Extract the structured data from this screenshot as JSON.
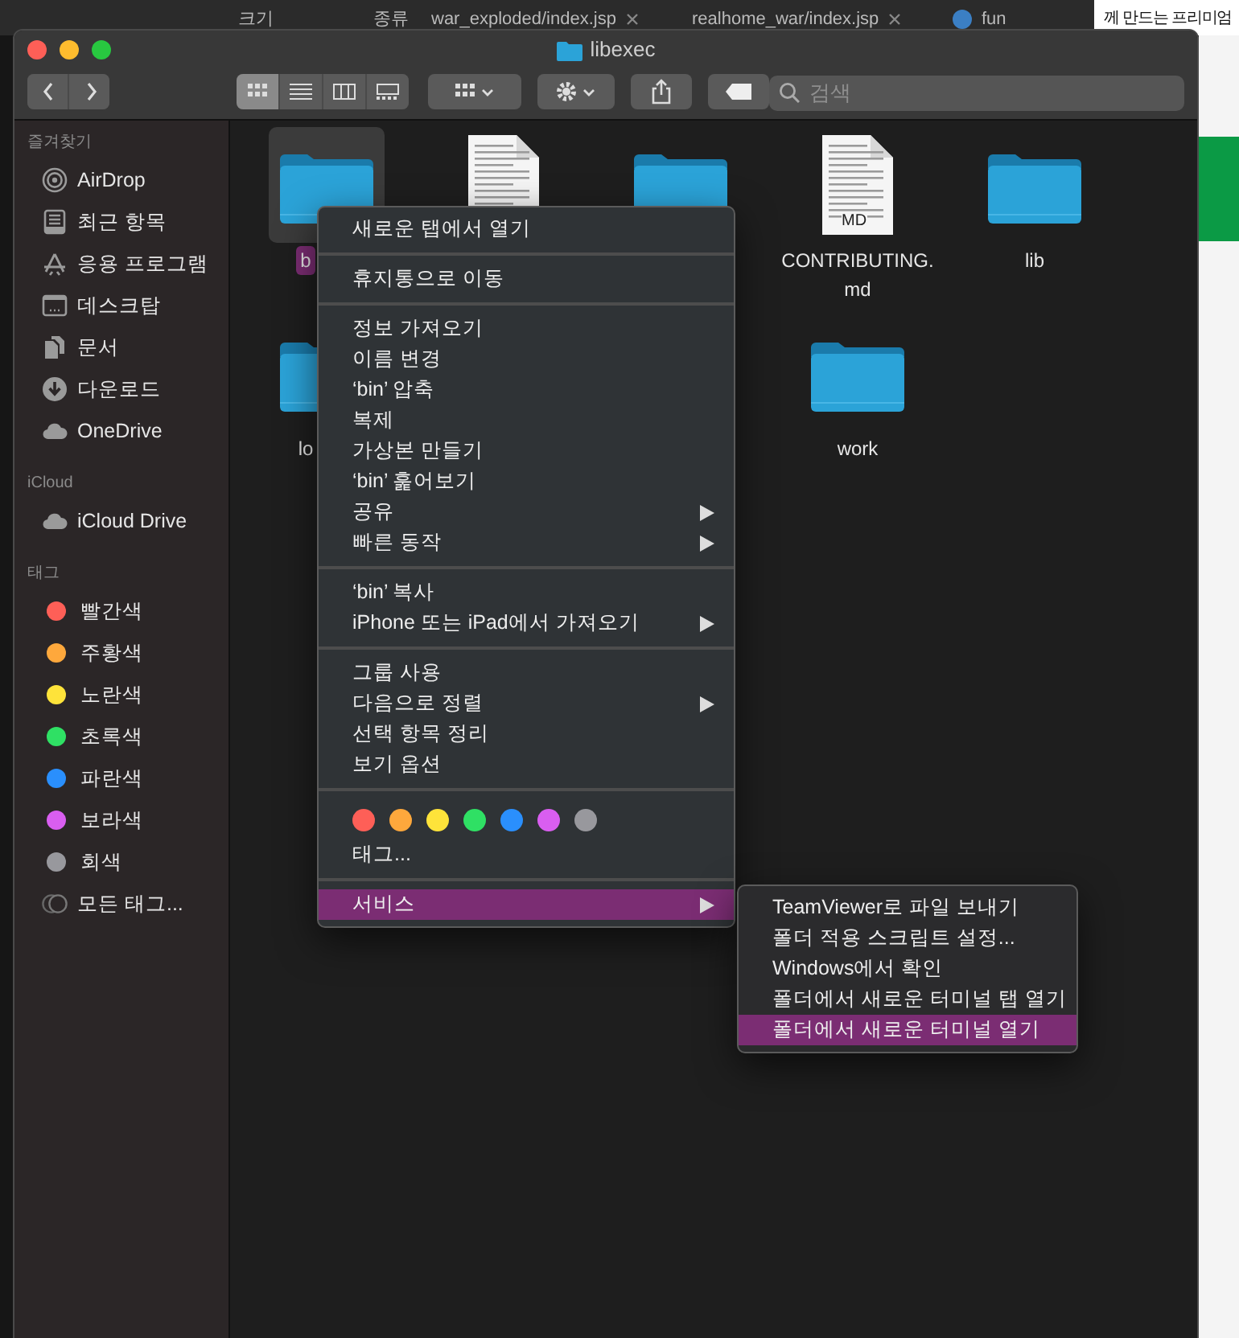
{
  "background_window": {
    "texts": [
      {
        "label": "크기"
      },
      {
        "label": "종류"
      },
      {
        "label": "war_exploded/index.jsp",
        "closable": true
      },
      {
        "label": "realhome_war/index.jsp",
        "closable": true
      },
      {
        "label": "fun",
        "closable": false
      },
      {
        "label": "께 만드는 프리미엄",
        "closable": false
      }
    ]
  },
  "window": {
    "title": "libexec"
  },
  "toolbar": {
    "views": [
      {
        "kind": "icons",
        "selected": true
      },
      {
        "kind": "list",
        "selected": false
      },
      {
        "kind": "columns",
        "selected": false
      },
      {
        "kind": "gallery",
        "selected": false
      }
    ],
    "search": {
      "placeholder": "검색"
    }
  },
  "sidebar": {
    "sections": [
      {
        "heading": "즐겨찾기",
        "items": [
          {
            "label": "AirDrop",
            "kind": "airdrop"
          },
          {
            "label": "최근 항목",
            "kind": "recents"
          },
          {
            "label": "응용 프로그램",
            "kind": "applications"
          },
          {
            "label": "데스크탑",
            "kind": "desktop"
          },
          {
            "label": "문서",
            "kind": "documents"
          },
          {
            "label": "다운로드",
            "kind": "downloads"
          },
          {
            "label": "OneDrive",
            "kind": "cloud"
          }
        ]
      },
      {
        "heading": "iCloud",
        "items": [
          {
            "label": "iCloud Drive",
            "kind": "cloud"
          }
        ]
      },
      {
        "heading": "태그",
        "items": [
          {
            "label": "빨간색",
            "kind": "tag",
            "color": "#fe5f57"
          },
          {
            "label": "주황색",
            "kind": "tag",
            "color": "#fea83c"
          },
          {
            "label": "노란색",
            "kind": "tag",
            "color": "#fee33a"
          },
          {
            "label": "초록색",
            "kind": "tag",
            "color": "#2fe064"
          },
          {
            "label": "파란색",
            "kind": "tag",
            "color": "#2a8ffd"
          },
          {
            "label": "보라색",
            "kind": "tag",
            "color": "#d95ef0"
          },
          {
            "label": "회색",
            "kind": "tag",
            "color": "#98989d"
          },
          {
            "label": "모든 태그...",
            "kind": "all-tags"
          }
        ]
      }
    ]
  },
  "files": {
    "rows": [
      [
        {
          "kind": "folder",
          "label": "b",
          "selected": true
        },
        {
          "kind": "document",
          "selected": false
        },
        {
          "kind": "folder",
          "selected": false
        },
        {
          "kind": "document",
          "badge": "MD",
          "label": "CONTRIBUTING.\nmd",
          "selected": false
        },
        {
          "kind": "folder",
          "label": "lib",
          "selected": false
        }
      ],
      [
        {
          "kind": "folder",
          "label": "lo",
          "selected": false
        },
        {
          "kind": "folder",
          "label": "work",
          "selected": false
        }
      ]
    ]
  },
  "context_menu": {
    "groups": [
      [
        {
          "label": "새로운 탭에서 열기",
          "submenu": false,
          "selected": false
        }
      ],
      [
        {
          "label": "휴지통으로 이동",
          "submenu": false,
          "selected": false
        }
      ],
      [
        {
          "label": "정보 가져오기",
          "submenu": false,
          "selected": false
        },
        {
          "label": "이름 변경",
          "submenu": false,
          "selected": false
        },
        {
          "label": "‘bin’ 압축",
          "submenu": false,
          "selected": false
        },
        {
          "label": "복제",
          "submenu": false,
          "selected": false
        },
        {
          "label": "가상본 만들기",
          "submenu": false,
          "selected": false
        },
        {
          "label": "‘bin’ 훑어보기",
          "submenu": false,
          "selected": false
        },
        {
          "label": "공유",
          "submenu": true,
          "selected": false
        },
        {
          "label": "빠른 동작",
          "submenu": true,
          "selected": false
        }
      ],
      [
        {
          "label": "‘bin’ 복사",
          "submenu": false,
          "selected": false
        },
        {
          "label": "iPhone 또는 iPad에서 가져오기",
          "submenu": true,
          "selected": false
        }
      ],
      [
        {
          "label": "그룹 사용",
          "submenu": false,
          "selected": false
        },
        {
          "label": "다음으로 정렬",
          "submenu": true,
          "selected": false
        },
        {
          "label": "선택 항목 정리",
          "submenu": false,
          "selected": false
        },
        {
          "label": "보기 옵션",
          "submenu": false,
          "selected": false
        }
      ],
      [
        {
          "kind": "tag-colors",
          "colors": [
            {
              "color": "#fe5f57"
            },
            {
              "color": "#fea83c"
            },
            {
              "color": "#fee33a"
            },
            {
              "color": "#2fe064"
            },
            {
              "color": "#2a8ffd"
            },
            {
              "color": "#d95ef0"
            },
            {
              "color": "#98989d"
            }
          ]
        },
        {
          "label": "태그...",
          "submenu": false,
          "selected": false
        }
      ],
      [
        {
          "label": "서비스",
          "submenu": true,
          "selected": true
        }
      ]
    ]
  },
  "services_submenu": {
    "items": [
      {
        "label": "TeamViewer로 파일 보내기",
        "selected": false
      },
      {
        "label": "폴더 적용 스크립트 설정...",
        "selected": false
      },
      {
        "label": "Windows에서 확인",
        "selected": false
      },
      {
        "label": "폴더에서 새로운 터미널 탭 열기",
        "selected": false
      },
      {
        "label": "폴더에서 새로운 터미널 열기",
        "selected": true
      }
    ]
  }
}
